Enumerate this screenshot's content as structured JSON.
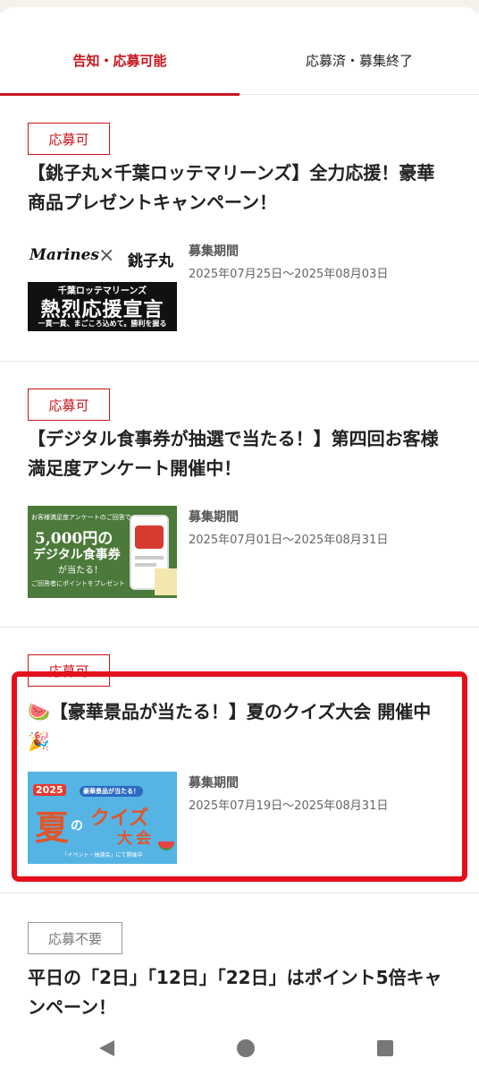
{
  "tabs": {
    "active_label": "告知・応募可能",
    "inactive_label": "応募済・募集終了"
  },
  "campaigns": [
    {
      "badge": "応募可",
      "title": "【銚子丸×千葉ロッテマリーンズ】全力応援！豪華商品プレゼントキャンペーン！",
      "period_label": "募集期間",
      "period_value": "2025年07月25日～2025年08月03日",
      "thumb": {
        "logo_left": "Marines",
        "cross": "×",
        "logo_right": "銚子丸",
        "band": "千葉ロッテマリーンズ",
        "headline": "熱烈応援宣言",
        "tagline": "一貫一貫、まごころ込めて。勝利を握る"
      }
    },
    {
      "badge": "応募可",
      "title": "【デジタル食事券が抽選で当たる！】第四回お客様満足度アンケート開催中！",
      "period_label": "募集期間",
      "period_value": "2025年07月01日～2025年08月31日",
      "thumb": {
        "line1": "お客様満足度アンケートのご回答で",
        "amount": "5,000円の",
        "line2": "デジタル食事券",
        "line3": "が当たる！",
        "line4": "ご回答者にポイントをプレゼント"
      }
    },
    {
      "badge": "応募可",
      "title": "🍉【豪華景品が当たる！】夏のクイズ大会 開催中🎉",
      "period_label": "募集期間",
      "period_value": "2025年07月19日～2025年08月31日",
      "thumb": {
        "year": "2025",
        "ribbon": "豪華景品が当たる！",
        "big1": "夏",
        "big2": "の",
        "big3": "クイズ",
        "big4": "大会",
        "footer": "「イベント・抽選会」にて開催中"
      }
    },
    {
      "badge": "応募不要",
      "title": "平日の「2日」「12日」「22日」はポイント5倍キャンペーン！"
    }
  ],
  "colors": {
    "accent": "#c8161d",
    "highlight": "#e4101c"
  },
  "navbar": {
    "back": "back-icon",
    "home": "home-icon",
    "recents": "recents-icon"
  }
}
